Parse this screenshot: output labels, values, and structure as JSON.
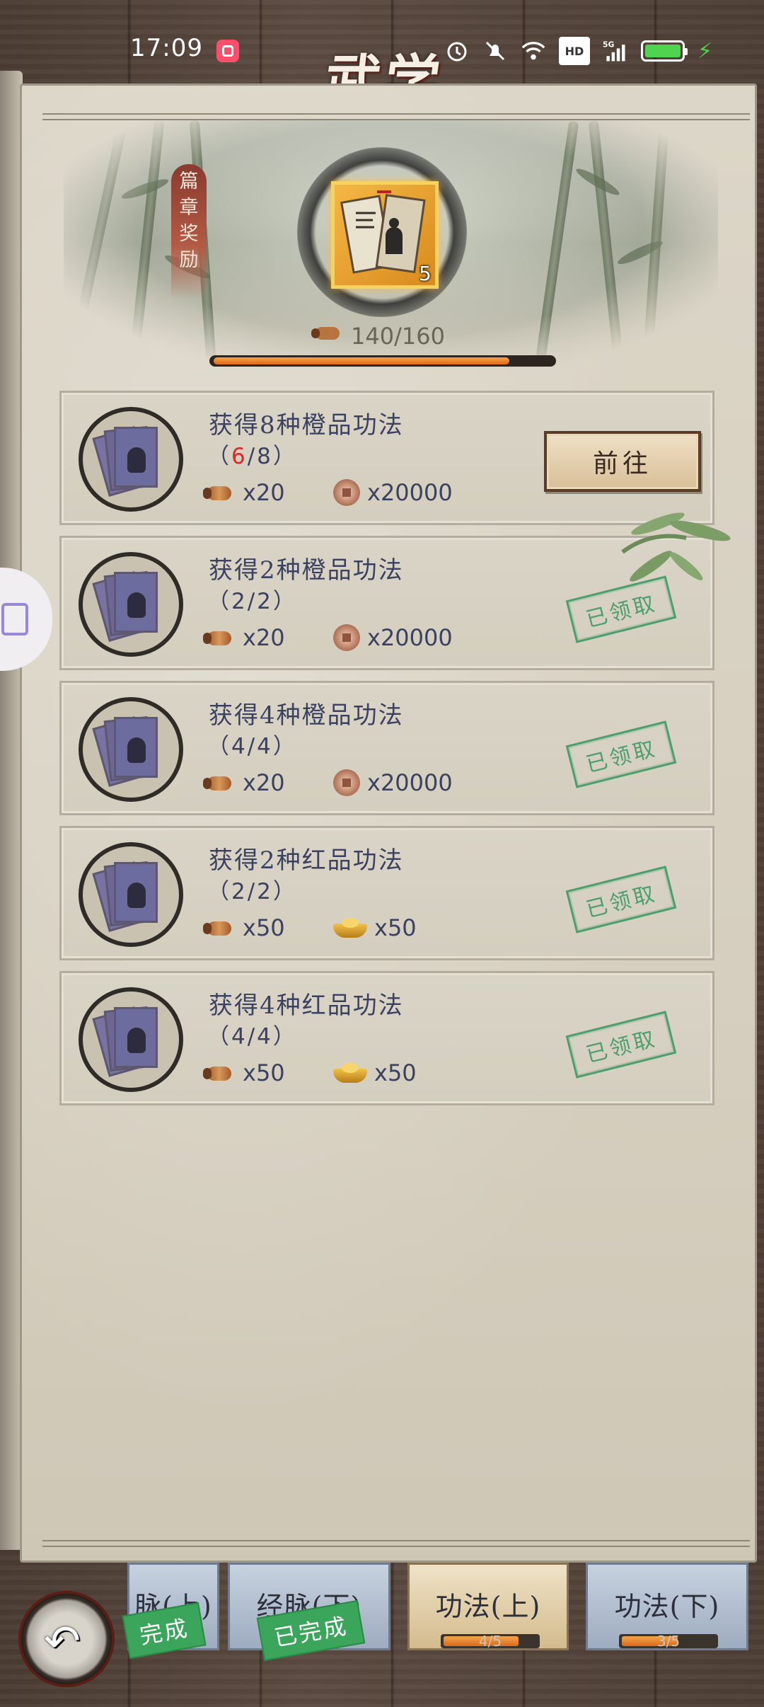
{
  "status_bar": {
    "time": "17:09",
    "icons": [
      "app-badge-icon",
      "alarm-icon",
      "mute-icon",
      "wifi-icon",
      "hd-icon",
      "signal-5g-icon",
      "battery-icon",
      "charging-icon"
    ],
    "hd_label": "HD",
    "network_label": "5G"
  },
  "header": {
    "title": "武学"
  },
  "chapter_reward": {
    "tag_label": "篇章奖励",
    "item_count": "5",
    "progress_text": "140/160",
    "progress_fraction": 0.875
  },
  "tasks": [
    {
      "title": "获得8种橙品功法",
      "progress_open": "（",
      "progress_current": "6",
      "progress_rest": "/8",
      "progress_close": "）",
      "progress_current_red": true,
      "reward1_count": "x20",
      "reward1_icon": "scroll-icon",
      "reward2_count": "x20000",
      "reward2_icon": "coin-icon",
      "action_label": "前往",
      "status": "go"
    },
    {
      "title": "获得2种橙品功法",
      "progress_open": "（",
      "progress_current": "2",
      "progress_rest": "/2",
      "progress_close": "）",
      "reward1_count": "x20",
      "reward1_icon": "scroll-icon",
      "reward2_count": "x20000",
      "reward2_icon": "coin-icon",
      "stamp_label": "已领取",
      "status": "claimed"
    },
    {
      "title": "获得4种橙品功法",
      "progress_open": "（",
      "progress_current": "4",
      "progress_rest": "/4",
      "progress_close": "）",
      "reward1_count": "x20",
      "reward1_icon": "scroll-icon",
      "reward2_count": "x20000",
      "reward2_icon": "coin-icon",
      "stamp_label": "已领取",
      "status": "claimed"
    },
    {
      "title": "获得2种红品功法",
      "progress_open": "（",
      "progress_current": "2",
      "progress_rest": "/2",
      "progress_close": "）",
      "reward1_count": "x50",
      "reward1_icon": "scroll-icon",
      "reward2_count": "x50",
      "reward2_icon": "gold-ingot-icon",
      "stamp_label": "已领取",
      "status": "claimed"
    },
    {
      "title": "获得4种红品功法",
      "progress_open": "（",
      "progress_current": "4",
      "progress_rest": "/4",
      "progress_close": "）",
      "reward1_count": "x50",
      "reward1_icon": "scroll-icon",
      "reward2_count": "x50",
      "reward2_icon": "gold-ingot-icon",
      "stamp_label": "已领取",
      "status": "claimed"
    }
  ],
  "bottom_tabs": [
    {
      "label": "脉(上)",
      "badge": "完成",
      "state": "done"
    },
    {
      "label": "经脉(下)",
      "badge": "已完成",
      "state": "done"
    },
    {
      "label": "功法(上)",
      "progress_text": "4/5",
      "progress_fraction": 0.8,
      "state": "active"
    },
    {
      "label": "功法(下)",
      "progress_text": "3/5",
      "progress_fraction": 0.6,
      "state": "inactive"
    }
  ],
  "colors": {
    "progress_orange": "#e16b16",
    "stamp_green": "#3e9a63",
    "highlight_red": "#d62b2b",
    "text_ink": "#3b4160"
  }
}
